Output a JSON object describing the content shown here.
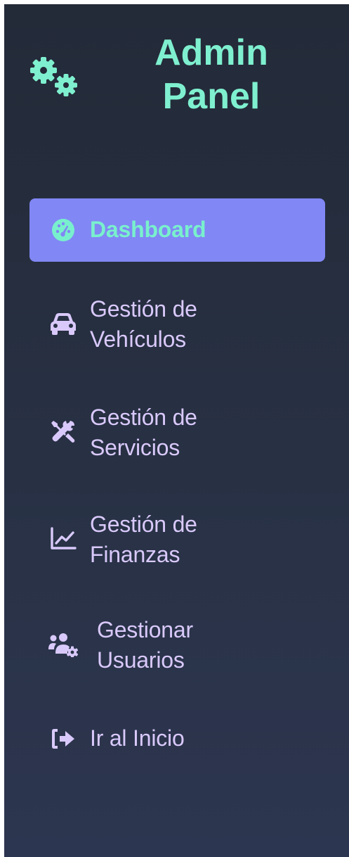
{
  "brand": {
    "title_line1": "Admin",
    "title_line2": "Panel",
    "icon": "gears-icon",
    "color": "#7ff0cf"
  },
  "nav": {
    "items": [
      {
        "label": "Dashboard",
        "icon": "tachometer-icon",
        "active": true
      },
      {
        "label": "Gestión de\nVehículos",
        "icon": "car-icon",
        "active": false
      },
      {
        "label": "Gestión de\nServicios",
        "icon": "tools-icon",
        "active": false
      },
      {
        "label": "Gestión de\nFinanzas",
        "icon": "chart-line-icon",
        "active": false
      },
      {
        "label": "Gestionar\nUsuarios",
        "icon": "users-cog-icon",
        "active": false
      },
      {
        "label": "Ir al Inicio",
        "icon": "sign-out-icon",
        "active": false
      }
    ]
  },
  "colors": {
    "sidebar_bg": "#283144",
    "active_bg": "#8187f4",
    "active_text": "#79f0cd",
    "item_text": "#d9c9fb"
  }
}
